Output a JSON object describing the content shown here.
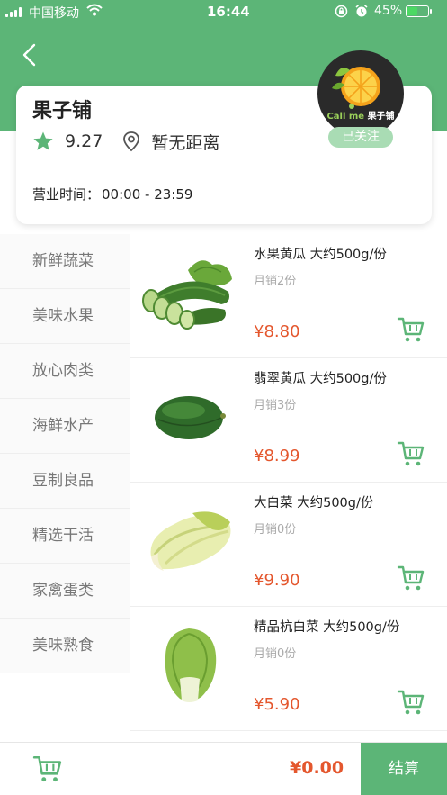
{
  "status_bar": {
    "carrier": "中国移动",
    "time": "16:44",
    "battery_pct": "45%",
    "battery_level": 0.45
  },
  "header": {
    "back_icon": "chevron-left-icon"
  },
  "shop": {
    "name": "果子铺",
    "rating": "9.27",
    "distance": "暂无距离",
    "hours_label": "营业时间：",
    "hours_value": "00:00 - 23:59",
    "logo_text_en": "Call me",
    "logo_text_cn": "果子铺",
    "follow_label": "已关注"
  },
  "categories": [
    {
      "label": "新鲜蔬菜"
    },
    {
      "label": "美味水果"
    },
    {
      "label": "放心肉类"
    },
    {
      "label": "海鲜水产"
    },
    {
      "label": "豆制良品"
    },
    {
      "label": "精选干活"
    },
    {
      "label": "家禽蛋类"
    },
    {
      "label": "美味熟食"
    }
  ],
  "products": [
    {
      "name": "水果黄瓜  大约500g/份",
      "sales": "月销2份",
      "price": "¥8.80",
      "image": "cucumber"
    },
    {
      "name": "翡翠黄瓜  大约500g/份",
      "sales": "月销3份",
      "price": "¥8.99",
      "image": "melon"
    },
    {
      "name": "大白菜  大约500g/份",
      "sales": "月销0份",
      "price": "¥9.90",
      "image": "napa-cabbage"
    },
    {
      "name": "精品杭白菜  大约500g/份",
      "sales": "月销0份",
      "price": "¥5.90",
      "image": "bok-choy"
    }
  ],
  "bottom_bar": {
    "total": "¥0.00",
    "checkout_label": "结算"
  },
  "colors": {
    "brand_green": "#5cb577",
    "price_red": "#e4572e",
    "follow_badge": "#a9dcb4"
  }
}
